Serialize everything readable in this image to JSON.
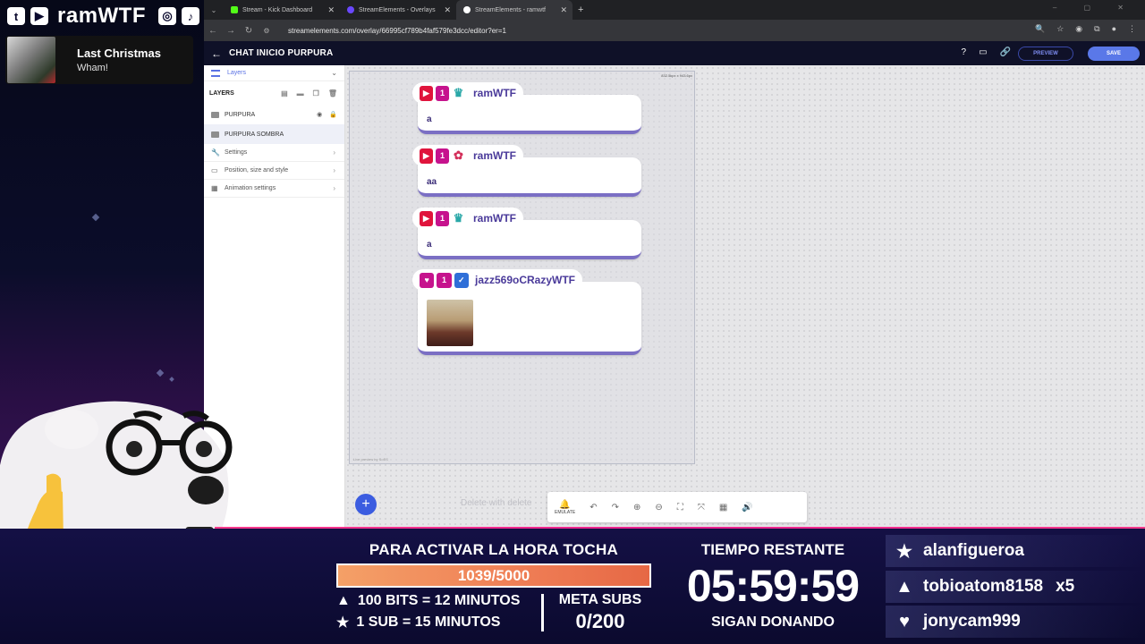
{
  "overlay": {
    "channel": "ramWTF",
    "social_icons": [
      "twitter-icon",
      "youtube-icon",
      "instagram-icon",
      "tiktok-icon"
    ],
    "music": {
      "song": "Last Christmas",
      "artist": "Wham!"
    }
  },
  "browser": {
    "tabs": [
      {
        "title": "Stream - Kick Dashboard",
        "color": "#53fc18",
        "active": false
      },
      {
        "title": "StreamElements - Overlays",
        "color": "#6a48ff",
        "active": false
      },
      {
        "title": "StreamElements - ramwtf",
        "color": "#ffffff",
        "active": true
      }
    ],
    "new_tab": "+",
    "url": "streamelements.com/overlay/66995cf789b4faf579fe3dcc/editor?er=1"
  },
  "editor": {
    "title": "CHAT INICIO PURPURA",
    "preview_label": "PREVIEW",
    "save_label": "SAVE",
    "panel": {
      "tab_label": "Layers",
      "layers_heading": "LAYERS",
      "layers": [
        {
          "name": "PURPURA",
          "selected": false
        },
        {
          "name": "PURPURA SOMBRA",
          "selected": true
        }
      ],
      "settings": [
        "Settings",
        "Position, size and style",
        "Animation settings"
      ]
    },
    "canvas": {
      "dimensions": "832.5kpx x 943.6px",
      "watermark": "Live preview by SoES",
      "messages": [
        {
          "user": "ramWTF",
          "text": "a"
        },
        {
          "user": "ramWTF",
          "text": "aa"
        },
        {
          "user": "ramWTF",
          "text": "a"
        },
        {
          "user": "jazz569oCRazyWTF",
          "text": ""
        }
      ]
    },
    "toolbar": {
      "delete_hint": "Delete with  delete",
      "emulate_label": "EMULATE"
    }
  },
  "stream_bar": {
    "hora_title": "PARA ACTIVAR LA HORA TOCHA",
    "progress_text": "1039/5000",
    "progress_fraction": 0.2078,
    "bits_rule": "100 BITS = 12 MINUTOS",
    "sub_rule": "1 SUB = 15 MINUTOS",
    "meta_label": "META SUBS",
    "meta_value": "0/200",
    "timer_label": "TIEMPO RESTANTE",
    "timer_value": "05:59:59",
    "timer_sub": "SIGAN DONANDO",
    "top_supporters": [
      {
        "icon": "star-icon",
        "name": "alanfigueroa",
        "extra": ""
      },
      {
        "icon": "diamond-icon",
        "name": "tobioatom8158",
        "extra": "x5"
      },
      {
        "icon": "heart-icon",
        "name": "jonycam999",
        "extra": ""
      }
    ]
  }
}
